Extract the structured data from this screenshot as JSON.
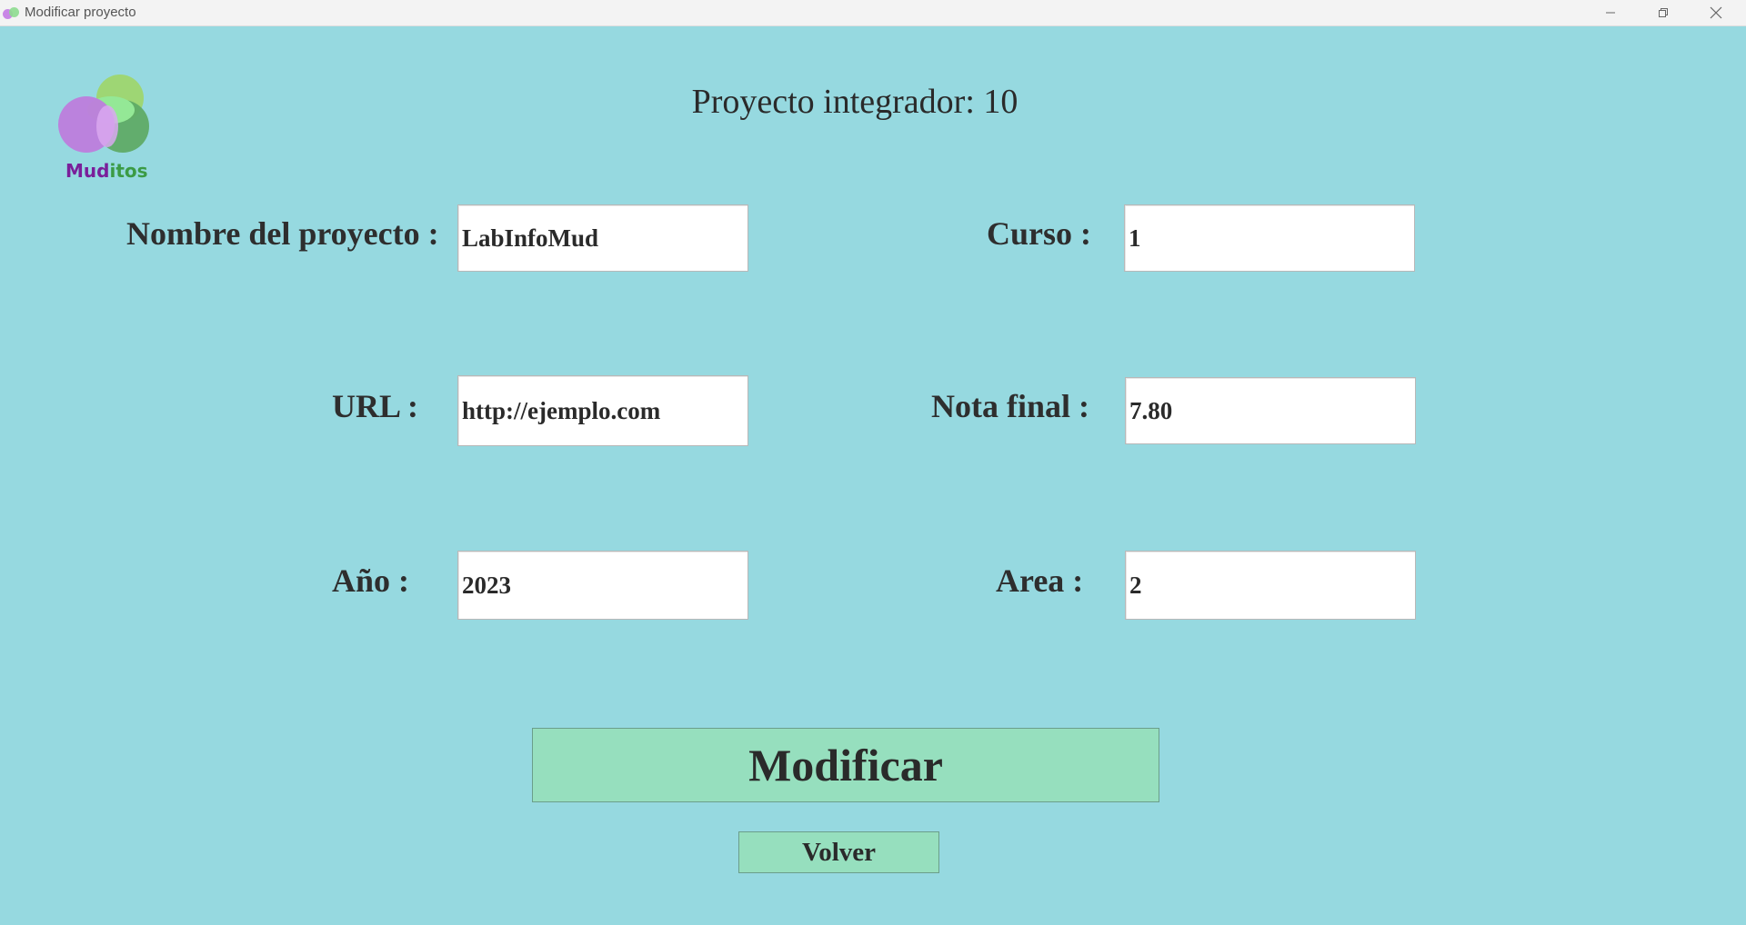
{
  "window": {
    "title": "Modificar proyecto"
  },
  "logo": {
    "text_part_a": "Mud",
    "text_part_b": "itos"
  },
  "header": {
    "title": "Proyecto integrador: 10"
  },
  "form": {
    "nombre": {
      "label": "Nombre del proyecto :",
      "value": "LabInfoMud"
    },
    "curso": {
      "label": "Curso :",
      "value": "1"
    },
    "url": {
      "label": "URL :",
      "value": "http://ejemplo.com"
    },
    "nota": {
      "label": "Nota final :",
      "value": "7.80"
    },
    "anio": {
      "label": "Año :",
      "value": "2023"
    },
    "area": {
      "label": "Area :",
      "value": "2"
    }
  },
  "actions": {
    "modificar_label": "Modificar",
    "volver_label": "Volver"
  },
  "colors": {
    "background": "#96d9e0",
    "button": "#96dfbe",
    "input_bg": "#ffffff"
  },
  "icons": {
    "minimize": "minimize-icon",
    "maximize": "restore-icon",
    "close": "close-icon"
  }
}
